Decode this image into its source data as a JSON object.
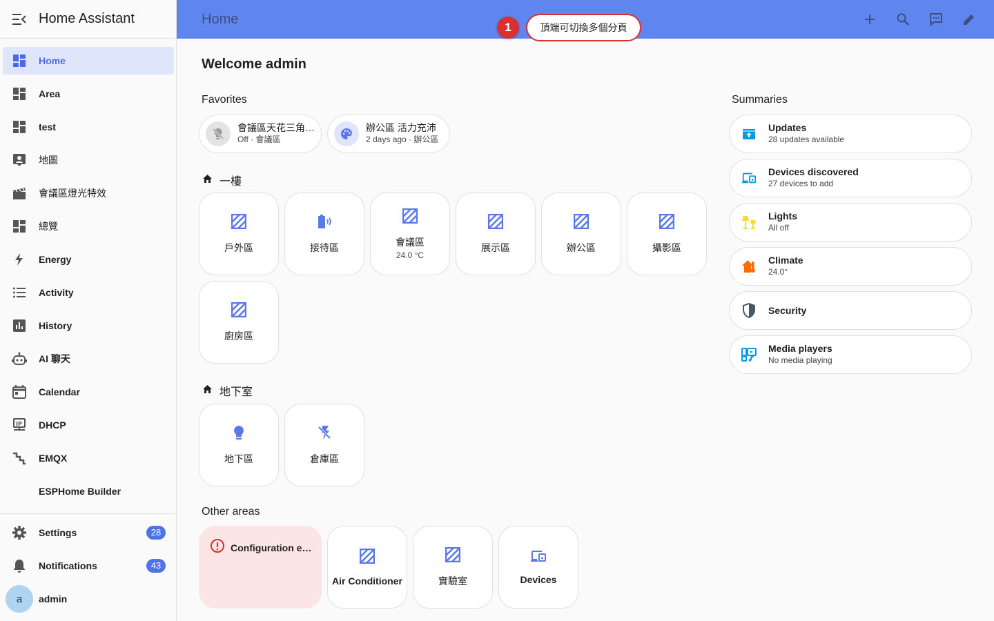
{
  "app": {
    "title": "Home Assistant"
  },
  "sidebar": {
    "items": [
      {
        "label": "Home",
        "icon": "view-dashboard-icon"
      },
      {
        "label": "Area",
        "icon": "view-dashboard-icon"
      },
      {
        "label": "test",
        "icon": "view-dashboard-icon"
      },
      {
        "label": "地圖",
        "icon": "account-box-icon"
      },
      {
        "label": "會議區燈光特效",
        "icon": "movie-open-icon"
      },
      {
        "label": "總覽",
        "icon": "view-dashboard-icon"
      },
      {
        "label": "Energy",
        "icon": "lightning-bolt-icon"
      },
      {
        "label": "Activity",
        "icon": "format-list-bulleted-icon"
      },
      {
        "label": "History",
        "icon": "chart-box-icon"
      },
      {
        "label": "AI 聊天",
        "icon": "robot-icon"
      },
      {
        "label": "Calendar",
        "icon": "calendar-icon"
      },
      {
        "label": "DHCP",
        "icon": "ip-network-icon"
      },
      {
        "label": "EMQX",
        "icon": "stairs-icon"
      },
      {
        "label": "ESPHome Builder",
        "icon": ""
      }
    ],
    "settings": {
      "label": "Settings",
      "badge": "28"
    },
    "notifications": {
      "label": "Notifications",
      "badge": "43"
    },
    "user": {
      "initial": "a",
      "name": "admin"
    }
  },
  "topbar": {
    "title": "Home",
    "icons": [
      "plus-icon",
      "search-icon",
      "assist-icon",
      "pencil-icon"
    ]
  },
  "annotation": {
    "number": "1",
    "text": "頂端可切換多個分頁"
  },
  "main": {
    "welcome": "Welcome admin",
    "favorites_title": "Favorites",
    "favorites": [
      {
        "name": "會議區天花三角…",
        "sub": "Off · 會議區",
        "icon": "lightbulb-off-icon"
      },
      {
        "name": "辦公區 活力充沛",
        "sub": "2 days ago · 辦公區",
        "icon": "palette-icon"
      }
    ],
    "floors": [
      {
        "name": "一樓",
        "areas": [
          {
            "name": "戶外區",
            "icon": "texture-box-icon"
          },
          {
            "name": "接待區",
            "icon": "battery-icon"
          },
          {
            "name": "會議區",
            "sub": "24.0 °C",
            "icon": "texture-box-icon"
          },
          {
            "name": "展示區",
            "icon": "texture-box-icon"
          },
          {
            "name": "辦公區",
            "icon": "texture-box-icon"
          },
          {
            "name": "攝影區",
            "icon": "texture-box-icon"
          },
          {
            "name": "廚房區",
            "icon": "texture-box-icon"
          }
        ]
      },
      {
        "name": "地下室",
        "areas": [
          {
            "name": "地下區",
            "icon": "lightbulb-icon"
          },
          {
            "name": "倉庫區",
            "icon": "flash-off-icon"
          }
        ]
      }
    ],
    "other_title": "Other areas",
    "other": [
      {
        "name": "Configuration error",
        "type": "error"
      },
      {
        "name": "Air Conditioner",
        "icon": "texture-box-icon"
      },
      {
        "name": "實驗室",
        "icon": "texture-box-icon"
      },
      {
        "name": "Devices",
        "icon": "devices-icon"
      }
    ]
  },
  "summaries": {
    "title": "Summaries",
    "items": [
      {
        "name": "Updates",
        "sub": "28 updates available",
        "icon": "package-up-icon",
        "color": "#039be5"
      },
      {
        "name": "Devices discovered",
        "sub": "27 devices to add",
        "icon": "devices-icon",
        "color": "#039be5"
      },
      {
        "name": "Lights",
        "sub": "All off",
        "icon": "lamps-icon",
        "color": "#fdd835"
      },
      {
        "name": "Climate",
        "sub": "24.0°",
        "icon": "home-thermometer-icon",
        "color": "#ff6d00"
      },
      {
        "name": "Security",
        "sub": "",
        "icon": "shield-icon",
        "color": "#455a64"
      },
      {
        "name": "Media players",
        "sub": "No media playing",
        "icon": "multimedia-icon",
        "color": "#039be5"
      }
    ]
  },
  "colors": {
    "accent": "#4b6ae6",
    "header": "#5f86ef",
    "area_icon": "#5a78e6",
    "error_bg": "#fce6e5",
    "marker": "#d93131"
  }
}
